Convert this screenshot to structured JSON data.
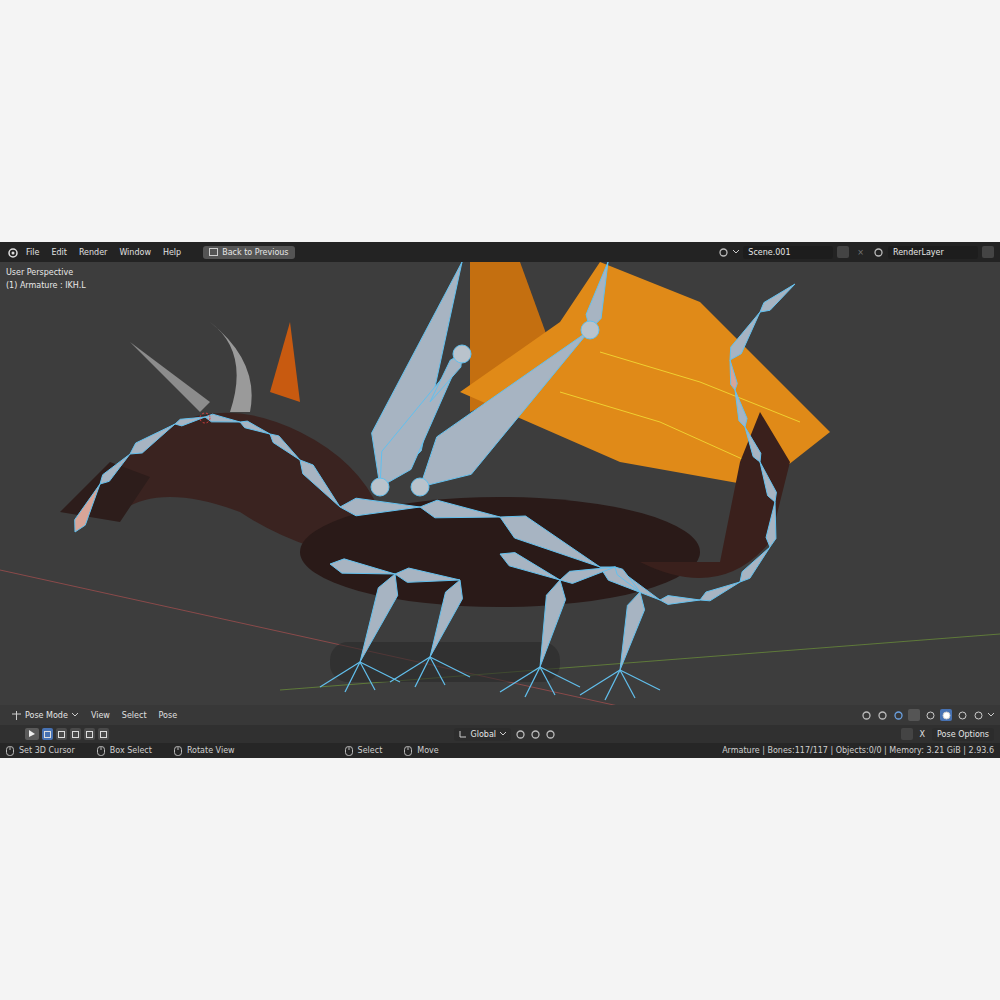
{
  "menu": [
    "File",
    "Edit",
    "Render",
    "Window",
    "Help"
  ],
  "back_button": "Back to Previous",
  "scene": "Scene.001",
  "render_layer": "RenderLayer",
  "viewport": {
    "view": "User Perspective",
    "active": "(1) Armature : IKH.L"
  },
  "header": {
    "mode": "Pose Mode",
    "menus": [
      "View",
      "Select",
      "Pose"
    ]
  },
  "select_modes": [
    {
      "selected": true
    },
    {
      "selected": false
    },
    {
      "selected": false
    },
    {
      "selected": false
    },
    {
      "selected": false
    }
  ],
  "shading": [
    {
      "selected": false
    },
    {
      "selected": true
    },
    {
      "selected": false
    },
    {
      "selected": false
    }
  ],
  "tool_settings": {
    "orientation": "Global",
    "close": "X",
    "pose_options": "Pose Options"
  },
  "status_bar": {
    "hints": [
      "Set 3D Cursor",
      "Box Select",
      "Rotate View",
      "Select",
      "Move"
    ],
    "stats": "Armature | Bones:117/117 | Objects:0/0 | Memory: 3.21 GiB | 2.93.6"
  }
}
